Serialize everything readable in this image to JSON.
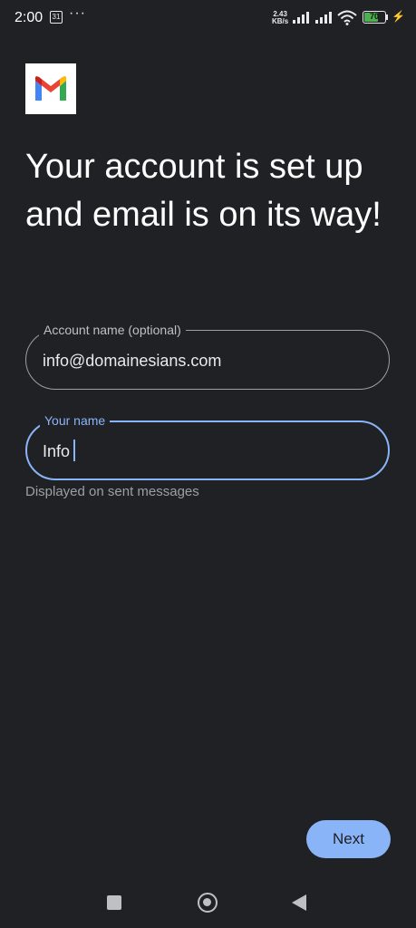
{
  "status_bar": {
    "time": "2:00",
    "calendar_day": "31",
    "more": "···",
    "net_speed_value": "2.43",
    "net_speed_unit": "KB/s",
    "battery_level": "70"
  },
  "logo": {
    "icon": "gmail-logo-icon"
  },
  "heading": "Your account is set up and email is on its way!",
  "fields": {
    "account_name": {
      "label": "Account name (optional)",
      "value": "info@domainesians.com"
    },
    "your_name": {
      "label": "Your name",
      "value": "Info",
      "helper": "Displayed on sent messages"
    }
  },
  "next_label": "Next",
  "colors": {
    "background": "#202124",
    "accent": "#8ab4f8",
    "text": "#e8eaed"
  }
}
